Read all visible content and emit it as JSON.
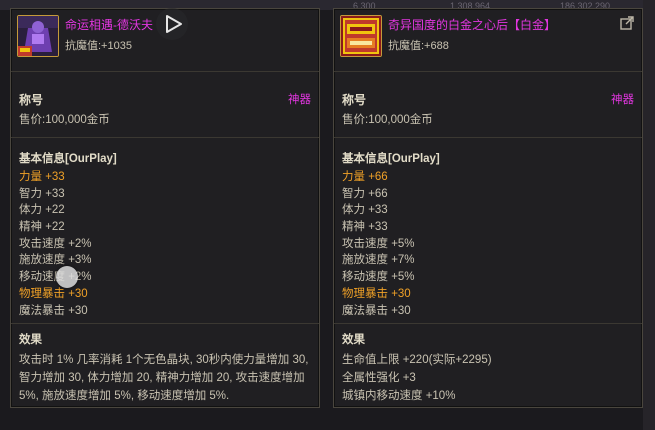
{
  "left": {
    "item_name": "命运相遇-德沃夫",
    "resist": "抗魔值:+1035",
    "title_label": "称号",
    "rarity": "神器",
    "price": "售价:100,000金币",
    "basic_info_title": "基本信息[OurPlay]",
    "stats": [
      {
        "text": "力量 +33",
        "highlight": true
      },
      {
        "text": "智力 +33",
        "highlight": false
      },
      {
        "text": "体力 +22",
        "highlight": false
      },
      {
        "text": "精神 +22",
        "highlight": false
      },
      {
        "text": "攻击速度 +2%",
        "highlight": false
      },
      {
        "text": "施放速度 +3%",
        "highlight": false
      },
      {
        "text": "移动速度 +2%",
        "highlight": false
      },
      {
        "text": "物理暴击 +30",
        "highlight": true
      },
      {
        "text": "魔法暴击 +30",
        "highlight": false
      }
    ],
    "effect_title": "效果",
    "effect_text": "攻击时 1% 几率消耗 1个无色晶块, 30秒内使力量增加 30, 智力增加 30, 体力增加 20, 精神力增加 20, 攻击速度增加 5%, 施放速度增加 5%, 移动速度增加 5%."
  },
  "right": {
    "item_name": "奇异国度的白金之心后【白金】",
    "resist": "抗魔值:+688",
    "title_label": "称号",
    "rarity": "神器",
    "price": "售价:100,000金币",
    "basic_info_title": "基本信息[OurPlay]",
    "stats": [
      {
        "text": "力量 +66",
        "highlight": true
      },
      {
        "text": "智力 +66",
        "highlight": false
      },
      {
        "text": "体力 +33",
        "highlight": false
      },
      {
        "text": "精神 +33",
        "highlight": false
      },
      {
        "text": "攻击速度 +5%",
        "highlight": false
      },
      {
        "text": "施放速度 +7%",
        "highlight": false
      },
      {
        "text": "移动速度 +5%",
        "highlight": false
      },
      {
        "text": "物理暴击 +30",
        "highlight": true
      },
      {
        "text": "魔法暴击 +30",
        "highlight": false
      }
    ],
    "effect_title": "效果",
    "effect_lines": [
      "生命值上限 +220(实际+2295)",
      "全属性强化 +3",
      "城镇内移动速度 +10%"
    ]
  },
  "background": {
    "ghost_numbers": [
      "6,300",
      "1,308,964",
      "186,302,290"
    ]
  },
  "icons": {
    "left_item": "purple-armored-character-icon",
    "right_item": "golden-card-icon",
    "share": "share-icon",
    "play": "play-button-icon"
  },
  "colors": {
    "item_name": "#e236e0",
    "highlight_stat": "#f0a127",
    "text": "#c9c3b2",
    "border": "#4a463e"
  }
}
